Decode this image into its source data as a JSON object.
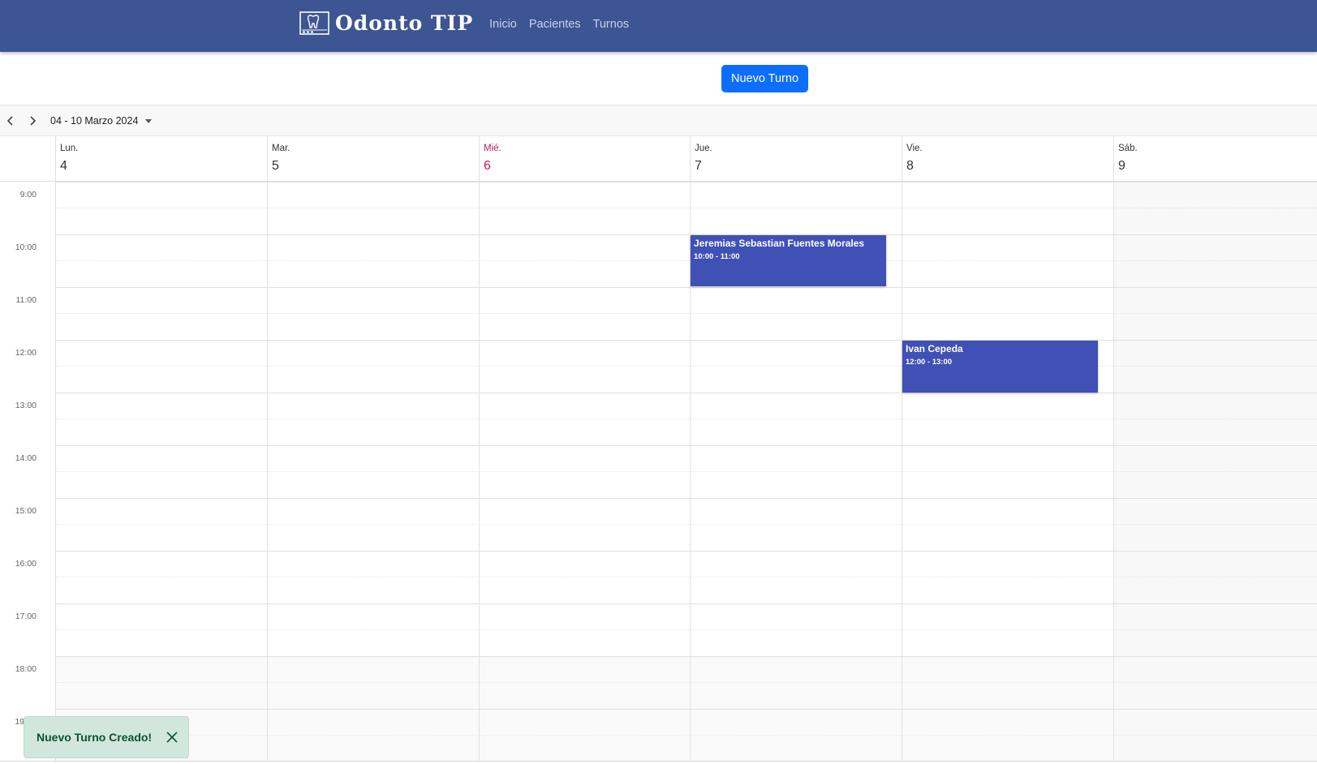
{
  "navbar": {
    "brand": "Odonto TIP",
    "links": [
      "Inicio",
      "Pacientes",
      "Turnos"
    ]
  },
  "toolbar": {
    "new_button": "Nuevo Turno"
  },
  "date_nav": {
    "range": "04 - 10 Marzo 2024"
  },
  "days": [
    {
      "name": "Lun.",
      "num": "4"
    },
    {
      "name": "Mar.",
      "num": "5"
    },
    {
      "name": "Mié.",
      "num": "6",
      "today": true
    },
    {
      "name": "Jue.",
      "num": "7"
    },
    {
      "name": "Vie.",
      "num": "8"
    },
    {
      "name": "Sáb.",
      "num": "9"
    }
  ],
  "hours": [
    "9:00",
    "10:00",
    "11:00",
    "12:00",
    "13:00",
    "14:00",
    "15:00",
    "16:00",
    "17:00",
    "18:00",
    "19"
  ],
  "events": [
    {
      "title": "Jeremias Sebastian Fuentes Morales",
      "time": "10:00 - 11:00",
      "day": "Jue.",
      "start_hour": "10:00",
      "end_hour": "11:00"
    },
    {
      "title": "Ivan Cepeda",
      "time": "12:00 - 13:00",
      "day": "Vie.",
      "start_hour": "12:00",
      "end_hour": "13:00"
    }
  ],
  "toast": {
    "message": "Nuevo Turno Creado!"
  },
  "colors": {
    "navbar": "#3d5592",
    "primary_button": "#0d6efd",
    "event": "#3f51b5",
    "today": "#c2185b",
    "toast_bg": "#d1e7dd",
    "toast_text": "#0f5132"
  }
}
